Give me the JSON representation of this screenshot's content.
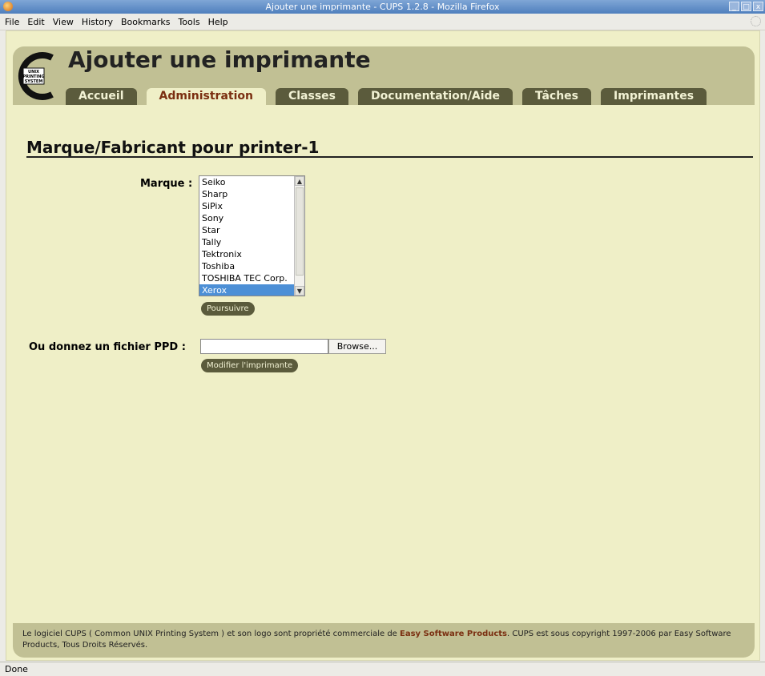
{
  "window": {
    "title": "Ajouter une imprimante - CUPS 1.2.8 - Mozilla Firefox",
    "buttons": [
      "_",
      "□",
      "x"
    ]
  },
  "menubar": {
    "items": [
      {
        "label": "File"
      },
      {
        "label": "Edit"
      },
      {
        "label": "View"
      },
      {
        "label": "History"
      },
      {
        "label": "Bookmarks"
      },
      {
        "label": "Tools"
      },
      {
        "label": "Help"
      }
    ]
  },
  "header": {
    "logo_text": [
      "UNIX",
      "PRINTING",
      "SYSTEM"
    ],
    "title": "Ajouter une imprimante",
    "tabs": [
      {
        "label": "Accueil",
        "active": false
      },
      {
        "label": "Administration",
        "active": true
      },
      {
        "label": "Classes",
        "active": false
      },
      {
        "label": "Documentation/Aide",
        "active": false
      },
      {
        "label": "Tâches",
        "active": false
      },
      {
        "label": "Imprimantes",
        "active": false
      }
    ]
  },
  "content": {
    "section_title": "Marque/Fabricant pour printer-1",
    "make_label": "Marque :",
    "makes": [
      "Seiko",
      "Sharp",
      "SiPix",
      "Sony",
      "Star",
      "Tally",
      "Tektronix",
      "Toshiba",
      "TOSHIBA TEC Corp.",
      "Xerox"
    ],
    "selected_make": "Xerox",
    "continue_button": "Poursuivre",
    "ppd_label": "Ou donnez un fichier PPD :",
    "ppd_value": "",
    "browse_button": "Browse...",
    "modify_button": "Modifier l'imprimante"
  },
  "footer": {
    "text_before": "Le logiciel CUPS ( Common UNIX Printing System ) et son logo sont propriété commerciale de ",
    "brand": "Easy Software Products",
    "text_after": ". CUPS est sous copyright 1997-2006 par Easy Software Products, Tous Droits Réservés."
  },
  "statusbar": {
    "text": "Done"
  },
  "colors": {
    "page_bg": "#efefc7",
    "header_bg": "#c1c094",
    "tab_bg": "#5b5b3c",
    "active_tab_text": "#7a2e10",
    "selection": "#4c8fd6"
  }
}
